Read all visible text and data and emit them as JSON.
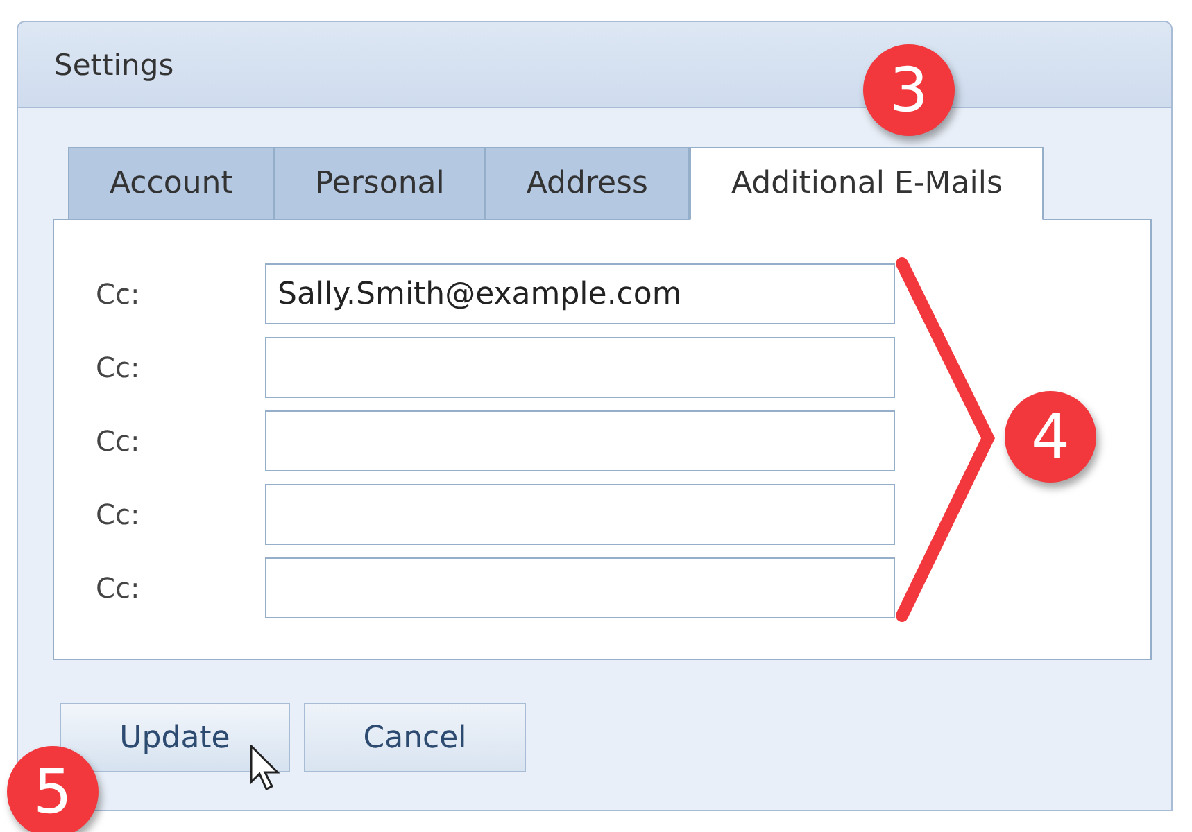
{
  "window": {
    "title": "Settings"
  },
  "tabs": [
    {
      "label": "Account",
      "selected": false
    },
    {
      "label": "Personal",
      "selected": false
    },
    {
      "label": "Address",
      "selected": false
    },
    {
      "label": "Additional E-Mails",
      "selected": true
    }
  ],
  "fields": [
    {
      "label": "Cc:",
      "value": "Sally.Smith@example.com"
    },
    {
      "label": "Cc:"
    },
    {
      "label": "Cc:"
    },
    {
      "label": "Cc:"
    },
    {
      "label": "Cc:"
    }
  ],
  "buttons": [
    {
      "label": "Update",
      "hovered": true
    },
    {
      "label": "Cancel",
      "hovered": false
    }
  ],
  "callouts": [
    {
      "number": "3",
      "kind": "badge"
    },
    {
      "number": "4",
      "kind": "bracket"
    },
    {
      "number": "5",
      "kind": "badge"
    }
  ]
}
